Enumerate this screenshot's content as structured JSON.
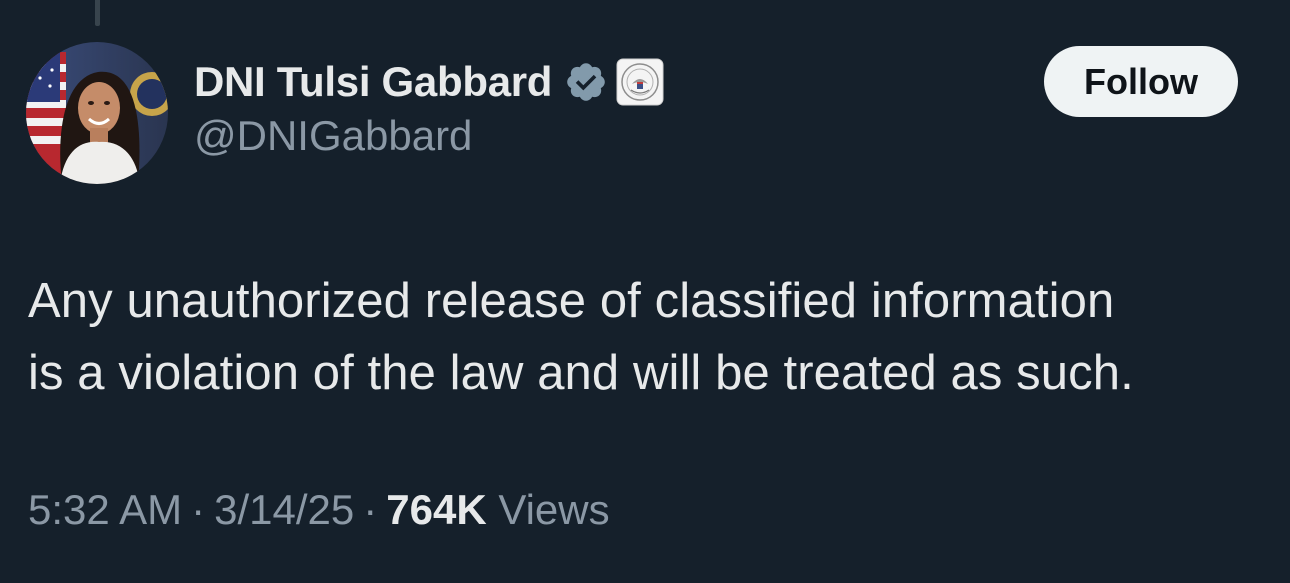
{
  "author": {
    "display_name": "DNI Tulsi Gabbard",
    "handle": "@DNIGabbard",
    "verified": true,
    "verified_icon": "verified-badge-icon",
    "affiliation_icon": "odni-seal-icon",
    "avatar": "profile-photo"
  },
  "actions": {
    "follow_label": "Follow"
  },
  "tweet": {
    "lines": [
      "Any unauthorized release of classified information",
      "is a violation of the law and will be treated as such."
    ]
  },
  "meta": {
    "time": "5:32 AM",
    "separator": "·",
    "date": "3/14/25",
    "views_count": "764K",
    "views_label": "Views"
  },
  "colors": {
    "background": "#15202b",
    "primary_text": "#e7e9ea",
    "secondary_text": "#8b98a5",
    "verified_badge": "#829aab",
    "follow_button_bg": "#eff3f4"
  }
}
